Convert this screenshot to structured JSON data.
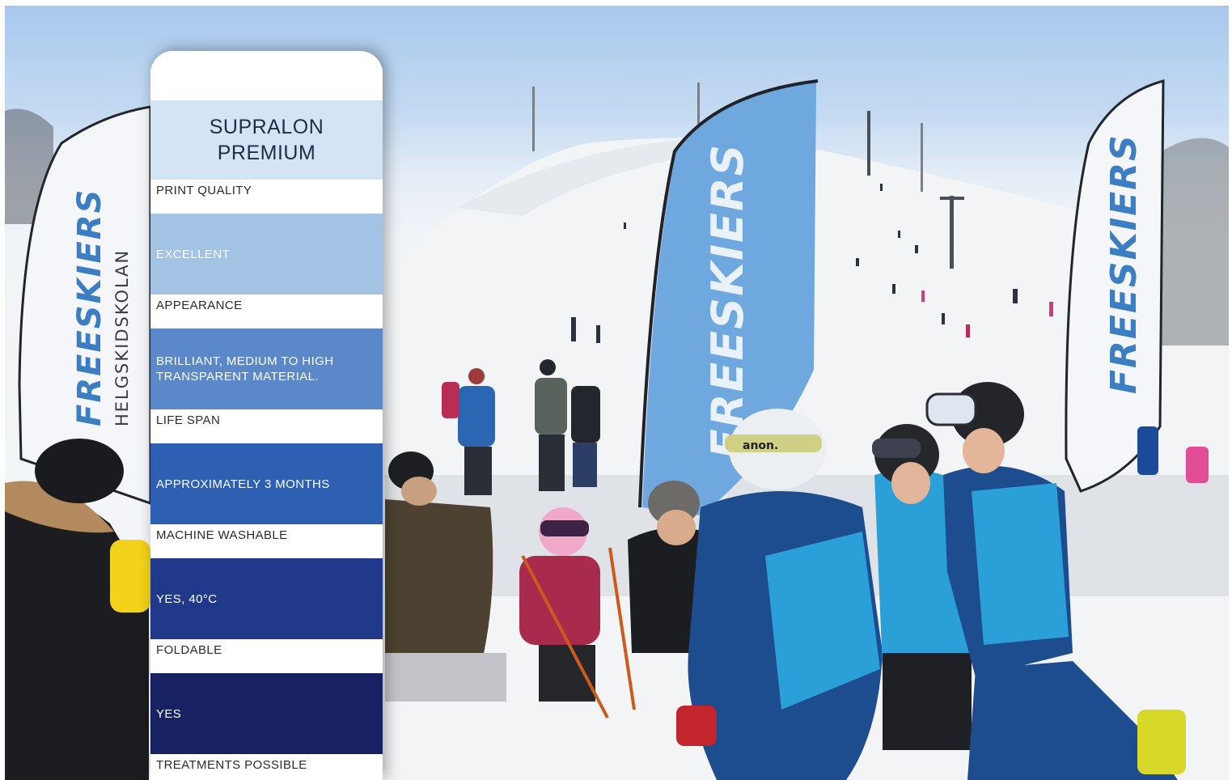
{
  "banners": {
    "left_flag": {
      "brand": "FREESKIERS",
      "subtext": "HELGSKIDSKOLAN"
    },
    "center_flag": {
      "brand": "FREESKIERS"
    },
    "right_flag": {
      "brand": "FREESKIERS"
    },
    "helmet_brand": "anon."
  },
  "colors": {
    "title_bg": "#d3e5f4",
    "value_1": "#a2c3e3",
    "value_2": "#5b88c9",
    "value_3": "#2d5fb2",
    "value_4": "#21398a",
    "value_5": "#182162"
  },
  "spec_card": {
    "title_line1": "SUPRALON",
    "title_line2": "PREMIUM",
    "rows": [
      {
        "label": "PRINT QUALITY",
        "value": "EXCELLENT"
      },
      {
        "label": "APPEARANCE",
        "value_line1": "BRILLIANT, MEDIUM TO HIGH",
        "value_line2": "TRANSPARENT MATERIAL."
      },
      {
        "label": "LIFE SPAN",
        "value": "APPROXIMATELY 3 MONTHS"
      },
      {
        "label": "MACHINE WASHABLE",
        "value": "YES, 40°C"
      },
      {
        "label": "FOLDABLE",
        "value": "YES"
      },
      {
        "label": "TREATMENTS POSSIBLE"
      }
    ]
  }
}
